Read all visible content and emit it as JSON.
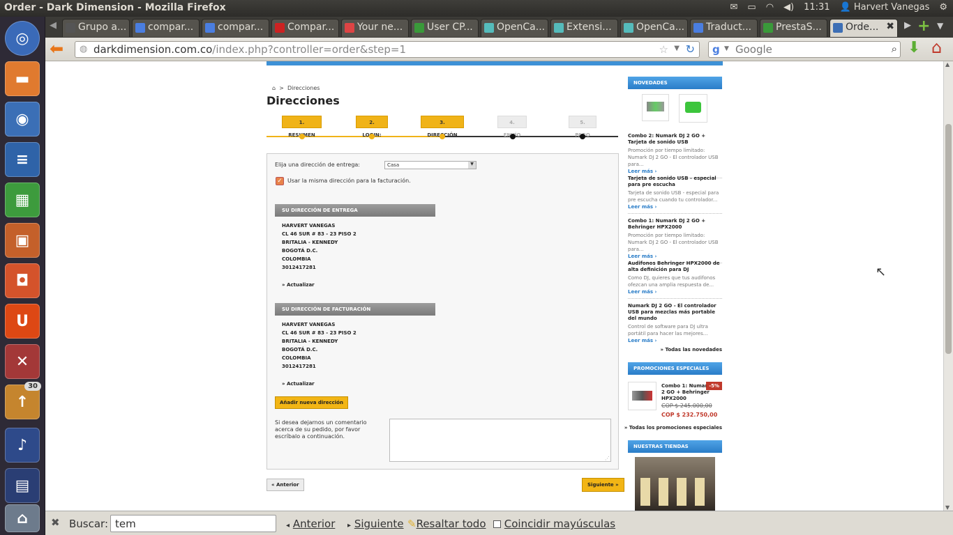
{
  "os": {
    "window_title": "Order - Dark Dimension - Mozilla Firefox",
    "clock": "11:31",
    "user": "Harvert Vanegas",
    "launcher_badge": "30"
  },
  "tabs": [
    {
      "label": "Grupo a...",
      "icon": "generic-page-icon"
    },
    {
      "label": "compar...",
      "icon": "google-icon"
    },
    {
      "label": "compar...",
      "icon": "google-icon"
    },
    {
      "label": "Compar...",
      "icon": "youtube-icon"
    },
    {
      "label": "Your ne...",
      "icon": "gmail-icon"
    },
    {
      "label": "User CP...",
      "icon": "forum-icon"
    },
    {
      "label": "OpenCa...",
      "icon": "opencart-icon"
    },
    {
      "label": "Extensi...",
      "icon": "opencart-icon"
    },
    {
      "label": "OpenCa...",
      "icon": "opencart-icon"
    },
    {
      "label": "Traduct...",
      "icon": "translate-icon"
    },
    {
      "label": "PrestaS...",
      "icon": "prestashop-icon"
    },
    {
      "label": "Orde...",
      "icon": "darkdimension-icon"
    }
  ],
  "nav": {
    "url_host": "darkdimension.com.co",
    "url_path": "/index.php?controller=order&step=1",
    "search_placeholder": "Google"
  },
  "page": {
    "breadcrumb": "Direcciones",
    "title": "Direcciones",
    "steps": [
      {
        "label": "1. RESUMEN",
        "active": true
      },
      {
        "label": "2. LOGIN:",
        "active": true
      },
      {
        "label": "3. DIRECCIÓN",
        "active": true
      },
      {
        "label": "4. ENVÍO",
        "active": false
      },
      {
        "label": "5. PAGO",
        "active": false
      }
    ],
    "choose_address_label": "Elija una dirección de entrega:",
    "choose_address_value": "Casa",
    "same_address_label": "Usar la misma dirección para la facturación.",
    "delivery_heading": "SU DIRECCIÓN DE ENTREGA",
    "billing_heading": "SU DIRECCIÓN DE FACTURACIÓN",
    "address_lines": [
      "HARVERT VANEGAS",
      "CL 46 SUR # 83 - 23 PISO 2",
      "BRITALIA - KENNEDY",
      "BOGOTÁ D.C.",
      "COLOMBIA",
      "3012417281"
    ],
    "update_link": "» Actualizar",
    "add_address_button": "Añadir nueva dirección",
    "comment_label": "Si desea dejarnos un comentario acerca de su pedido, por favor escríbalo a continuación.",
    "prev_button": "« Anterior",
    "next_button": "Siguiente »"
  },
  "sidebar": {
    "new_heading": "NOVEDADES",
    "new_items": [
      {
        "title": "Combo 2: Numark DJ 2 GO + Tarjeta de sonido USB",
        "desc": "Promoción por tiempo limitado: Numark DJ 2 GO - El controlador USB para...",
        "more": "Leer más"
      },
      {
        "title": "Tarjeta de sonido USB - especial para pre escucha",
        "desc": "Tarjeta de sonido USB - especial para pre escucha cuando tu controlador...",
        "more": "Leer más"
      },
      {
        "title": "Combo 1: Numark DJ 2 GO + Behringer HPX2000",
        "desc": "Promoción por tiempo limitado: Numark DJ 2 GO - El controlador USB para...",
        "more": "Leer más"
      },
      {
        "title": "Audifonos Behringer HPX2000 de alta definición para DJ",
        "desc": "Como DJ, quieres que tus audifonos ofezcan una amplia respuesta de...",
        "more": "Leer más"
      },
      {
        "title": "Numark DJ 2 GO - El controlador USB para mezclas más portable del mundo",
        "desc": "Control de software para DJ ultra portátil para hacer las mejores...",
        "more": "Leer más"
      }
    ],
    "all_new_link": "» Todas las novedades",
    "promo_heading": "PROMOCIONES ESPECIALES",
    "promo": {
      "title": "Combo 1: Numark DJ 2 GO + Behringer HPX2000",
      "discount": "-5%",
      "old_price": "COP $ 245.000,00",
      "new_price": "COP $ 232.750,00"
    },
    "all_promo_link": "» Todas los promociones especiales",
    "stores_heading": "NUESTRAS TIENDAS"
  },
  "findbar": {
    "label": "Buscar:",
    "value": "tem",
    "prev": "Anterior",
    "next": "Siguiente",
    "highlight": "Resaltar todo",
    "match_case": "Coincidir mayúsculas"
  }
}
